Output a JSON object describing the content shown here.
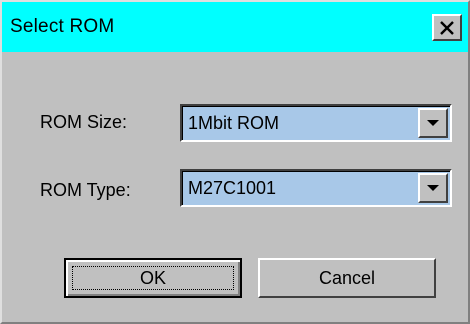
{
  "window": {
    "title": "Select ROM",
    "close_icon": "close-x-icon"
  },
  "fields": {
    "rom_size": {
      "label": "ROM Size:",
      "value": "1Mbit ROM"
    },
    "rom_type": {
      "label": "ROM Type:",
      "value": "M27C1001"
    }
  },
  "buttons": {
    "ok_label": "OK",
    "cancel_label": "Cancel"
  },
  "colors": {
    "titlebar": "#00ffff",
    "dialog_face": "#c0c0c0",
    "combo_highlight": "#a8c8e8"
  }
}
